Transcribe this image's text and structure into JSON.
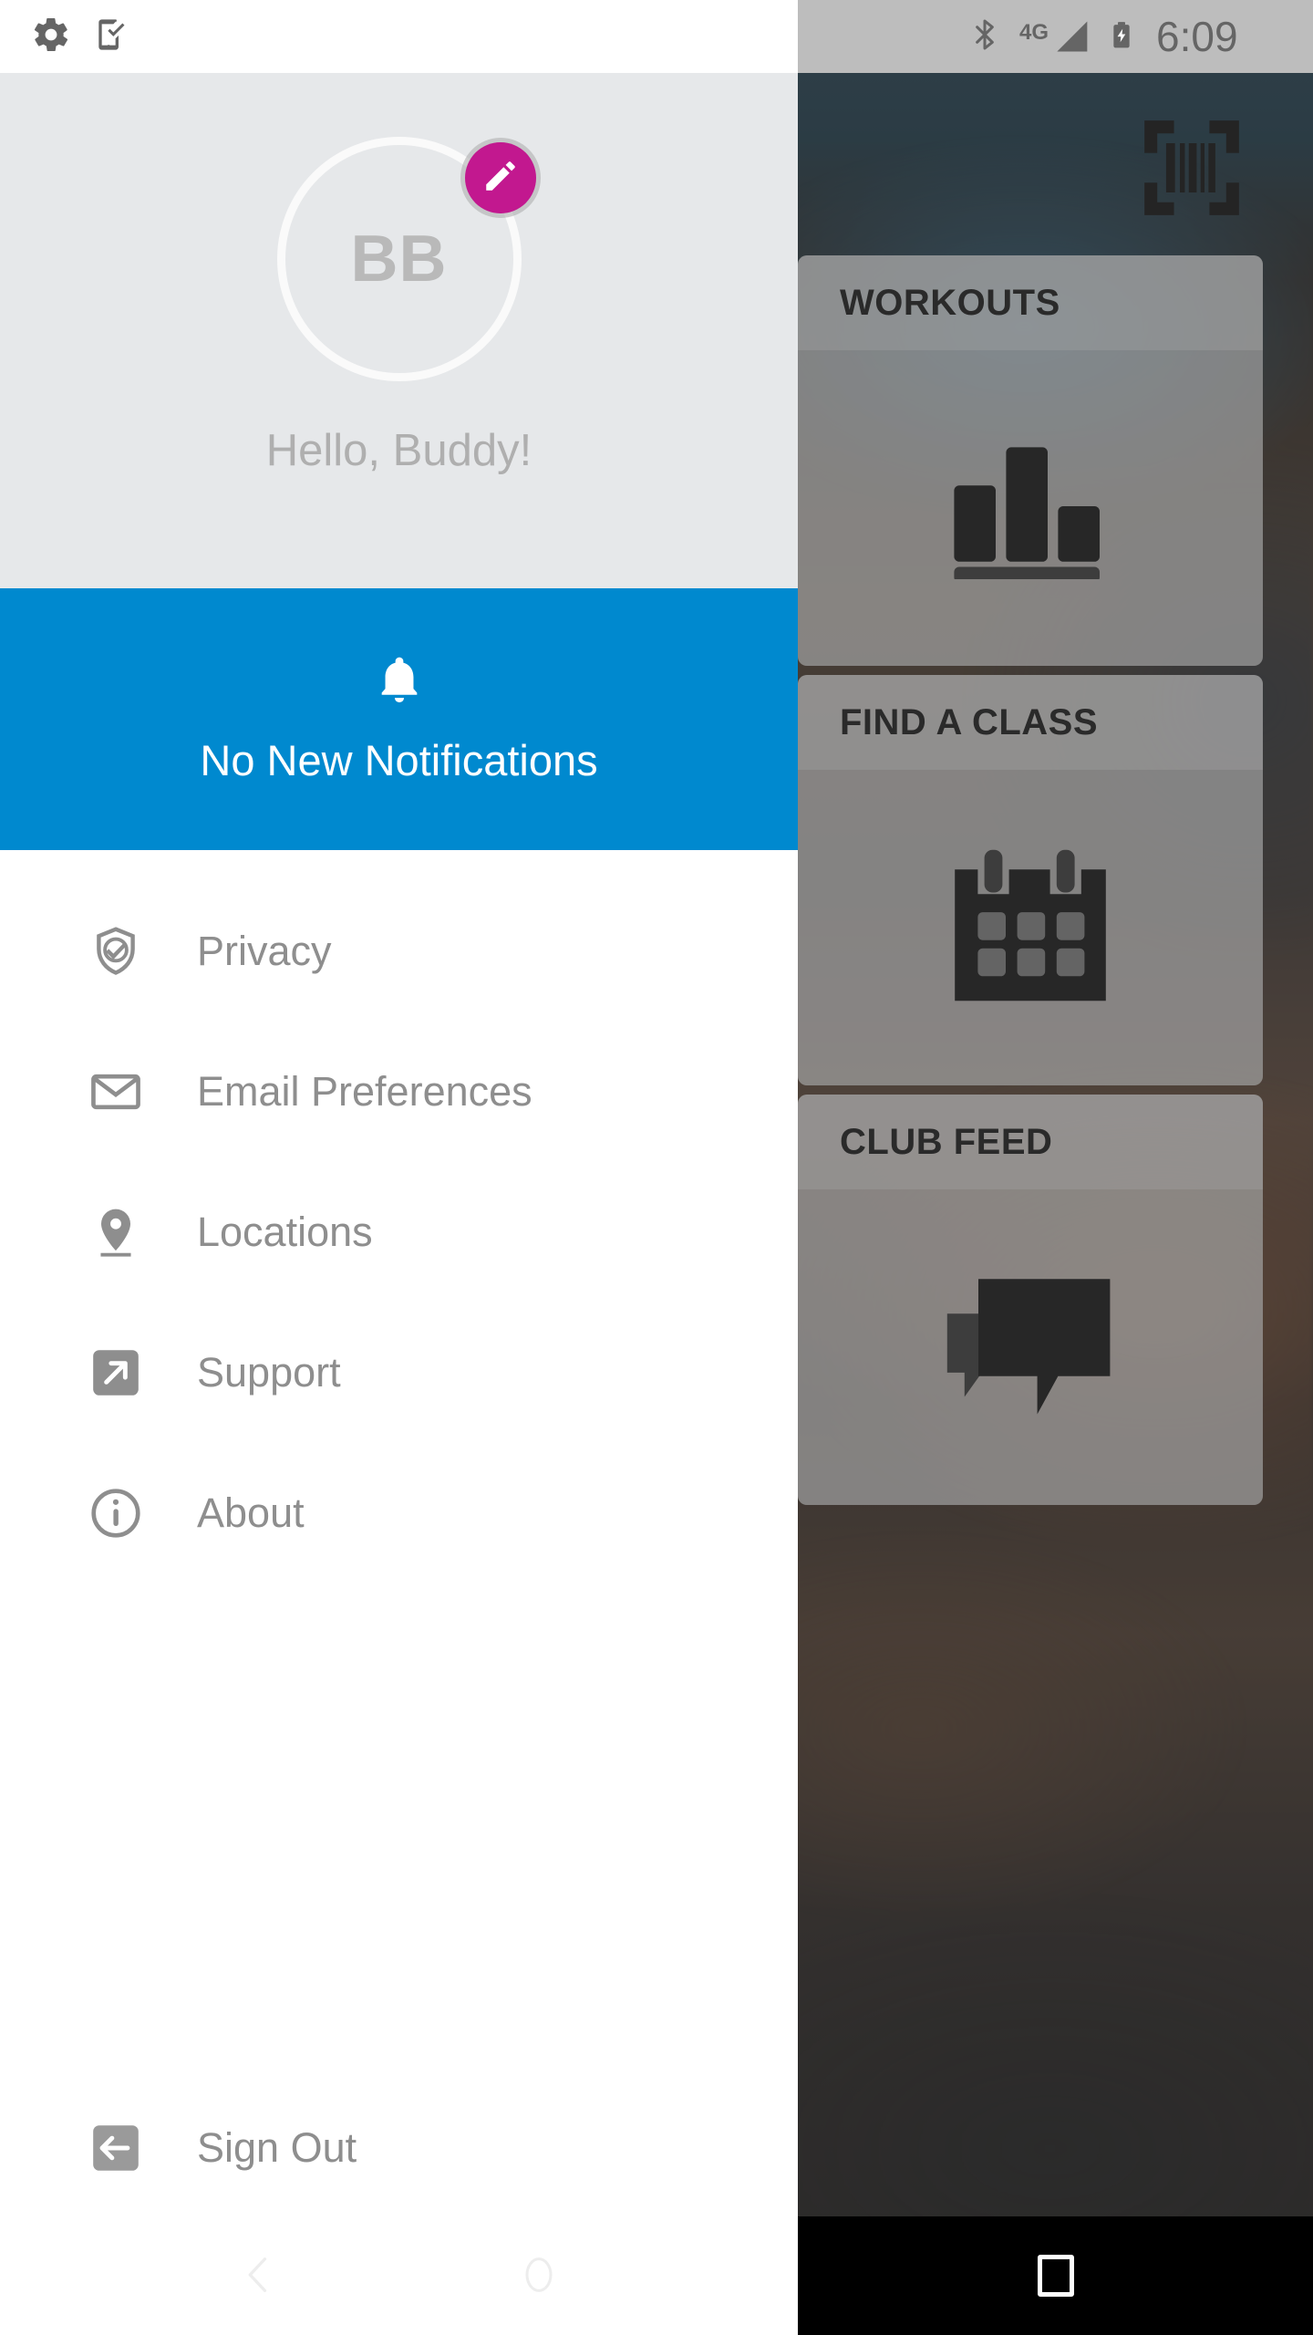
{
  "status_bar": {
    "time": "6:09",
    "left_icons": [
      "gear-icon",
      "phone-check-icon"
    ],
    "right_icons": [
      "bluetooth-icon",
      "signal-4g-icon",
      "battery-charging-icon"
    ],
    "network_label": "4G"
  },
  "drawer": {
    "profile": {
      "initials": "BB",
      "greeting": "Hello, Buddy!",
      "edit_badge_icon": "pencil-icon",
      "edit_badge_color": "#C2188F",
      "header_bg": "#E6E8EA"
    },
    "notification": {
      "icon": "bell-icon",
      "label": "No New Notifications",
      "bg_color": "#0089CF",
      "text_color": "#FFFFFF"
    },
    "menu": [
      {
        "label": "Privacy",
        "icon": "shield-check-icon"
      },
      {
        "label": "Email Preferences",
        "icon": "envelope-icon"
      },
      {
        "label": "Locations",
        "icon": "map-pin-icon"
      },
      {
        "label": "Support",
        "icon": "external-link-icon"
      },
      {
        "label": "About",
        "icon": "info-circle-icon"
      }
    ],
    "sign_out": {
      "label": "Sign Out",
      "icon": "logout-arrow-icon"
    }
  },
  "background_app": {
    "scan_icon": "barcode-scan-icon",
    "cards": [
      {
        "title": "WORKOUTS",
        "icon": "bar-chart-icon"
      },
      {
        "title": "FIND A CLASS",
        "icon": "calendar-icon"
      },
      {
        "title": "CLUB FEED",
        "icon": "chat-bubbles-icon"
      }
    ]
  },
  "nav_bar": {
    "back": "back-chevron-icon",
    "home": "home-circle-icon",
    "recents": "recents-square-icon"
  }
}
